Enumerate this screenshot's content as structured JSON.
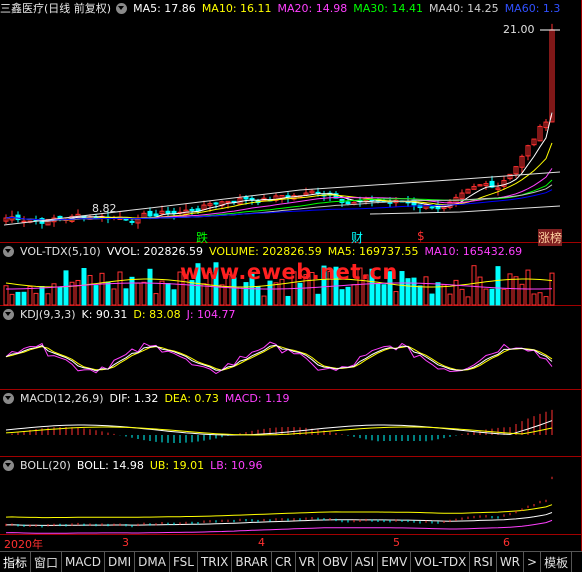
{
  "main": {
    "stock_title": "三鑫医疗(日线 前复权)",
    "ma5": "MA5: 17.86",
    "ma10": "MA10: 16.11",
    "ma20": "MA20: 14.98",
    "ma30": "MA30: 14.41",
    "ma40": "MA40: 14.25",
    "ma60": "MA60: 1.3",
    "high_label": "21.00",
    "low_label": "8.82",
    "markers": [
      "跌",
      "财",
      "$",
      "涨榜"
    ]
  },
  "volume": {
    "title": "VOL-TDX(5,10)",
    "vvol": "VVOL: 202826.59",
    "volume": "VOLUME: 202826.59",
    "ma5": "MA5: 169737.55",
    "ma10": "MA10: 165432.69"
  },
  "kdj": {
    "title": "KDJ(9,3,3)",
    "k": "K: 90.31",
    "d": "D: 83.08",
    "j": "J: 104.77"
  },
  "macd": {
    "title": "MACD(12,26,9)",
    "dif": "DIF: 1.32",
    "dea": "DEA: 0.73",
    "macd": "MACD: 1.19"
  },
  "boll": {
    "title": "BOLL(20)",
    "boll": "BOLL: 14.98",
    "ub": "UB: 19.01",
    "lb": "LB: 10.96"
  },
  "time_axis": [
    "2020年",
    "3",
    "4",
    "5",
    "6"
  ],
  "watermark": "www.eweb.net.cn",
  "tabs": [
    "指标",
    "窗口",
    "MACD",
    "DMI",
    "DMA",
    "FSL",
    "TRIX",
    "BRAR",
    "CR",
    "VR",
    "OBV",
    "ASI",
    "EMV",
    "VOL-TDX",
    "RSI",
    "WR",
    ">",
    "模板"
  ],
  "colors": {
    "up": "#ff3030",
    "down": "#00ffff",
    "ma5": "#ffffff",
    "ma10": "#ffff00",
    "ma20": "#ff40ff",
    "ma30": "#00ff00",
    "ma40": "#c0c0c0",
    "ma60": "#0000ff"
  }
}
